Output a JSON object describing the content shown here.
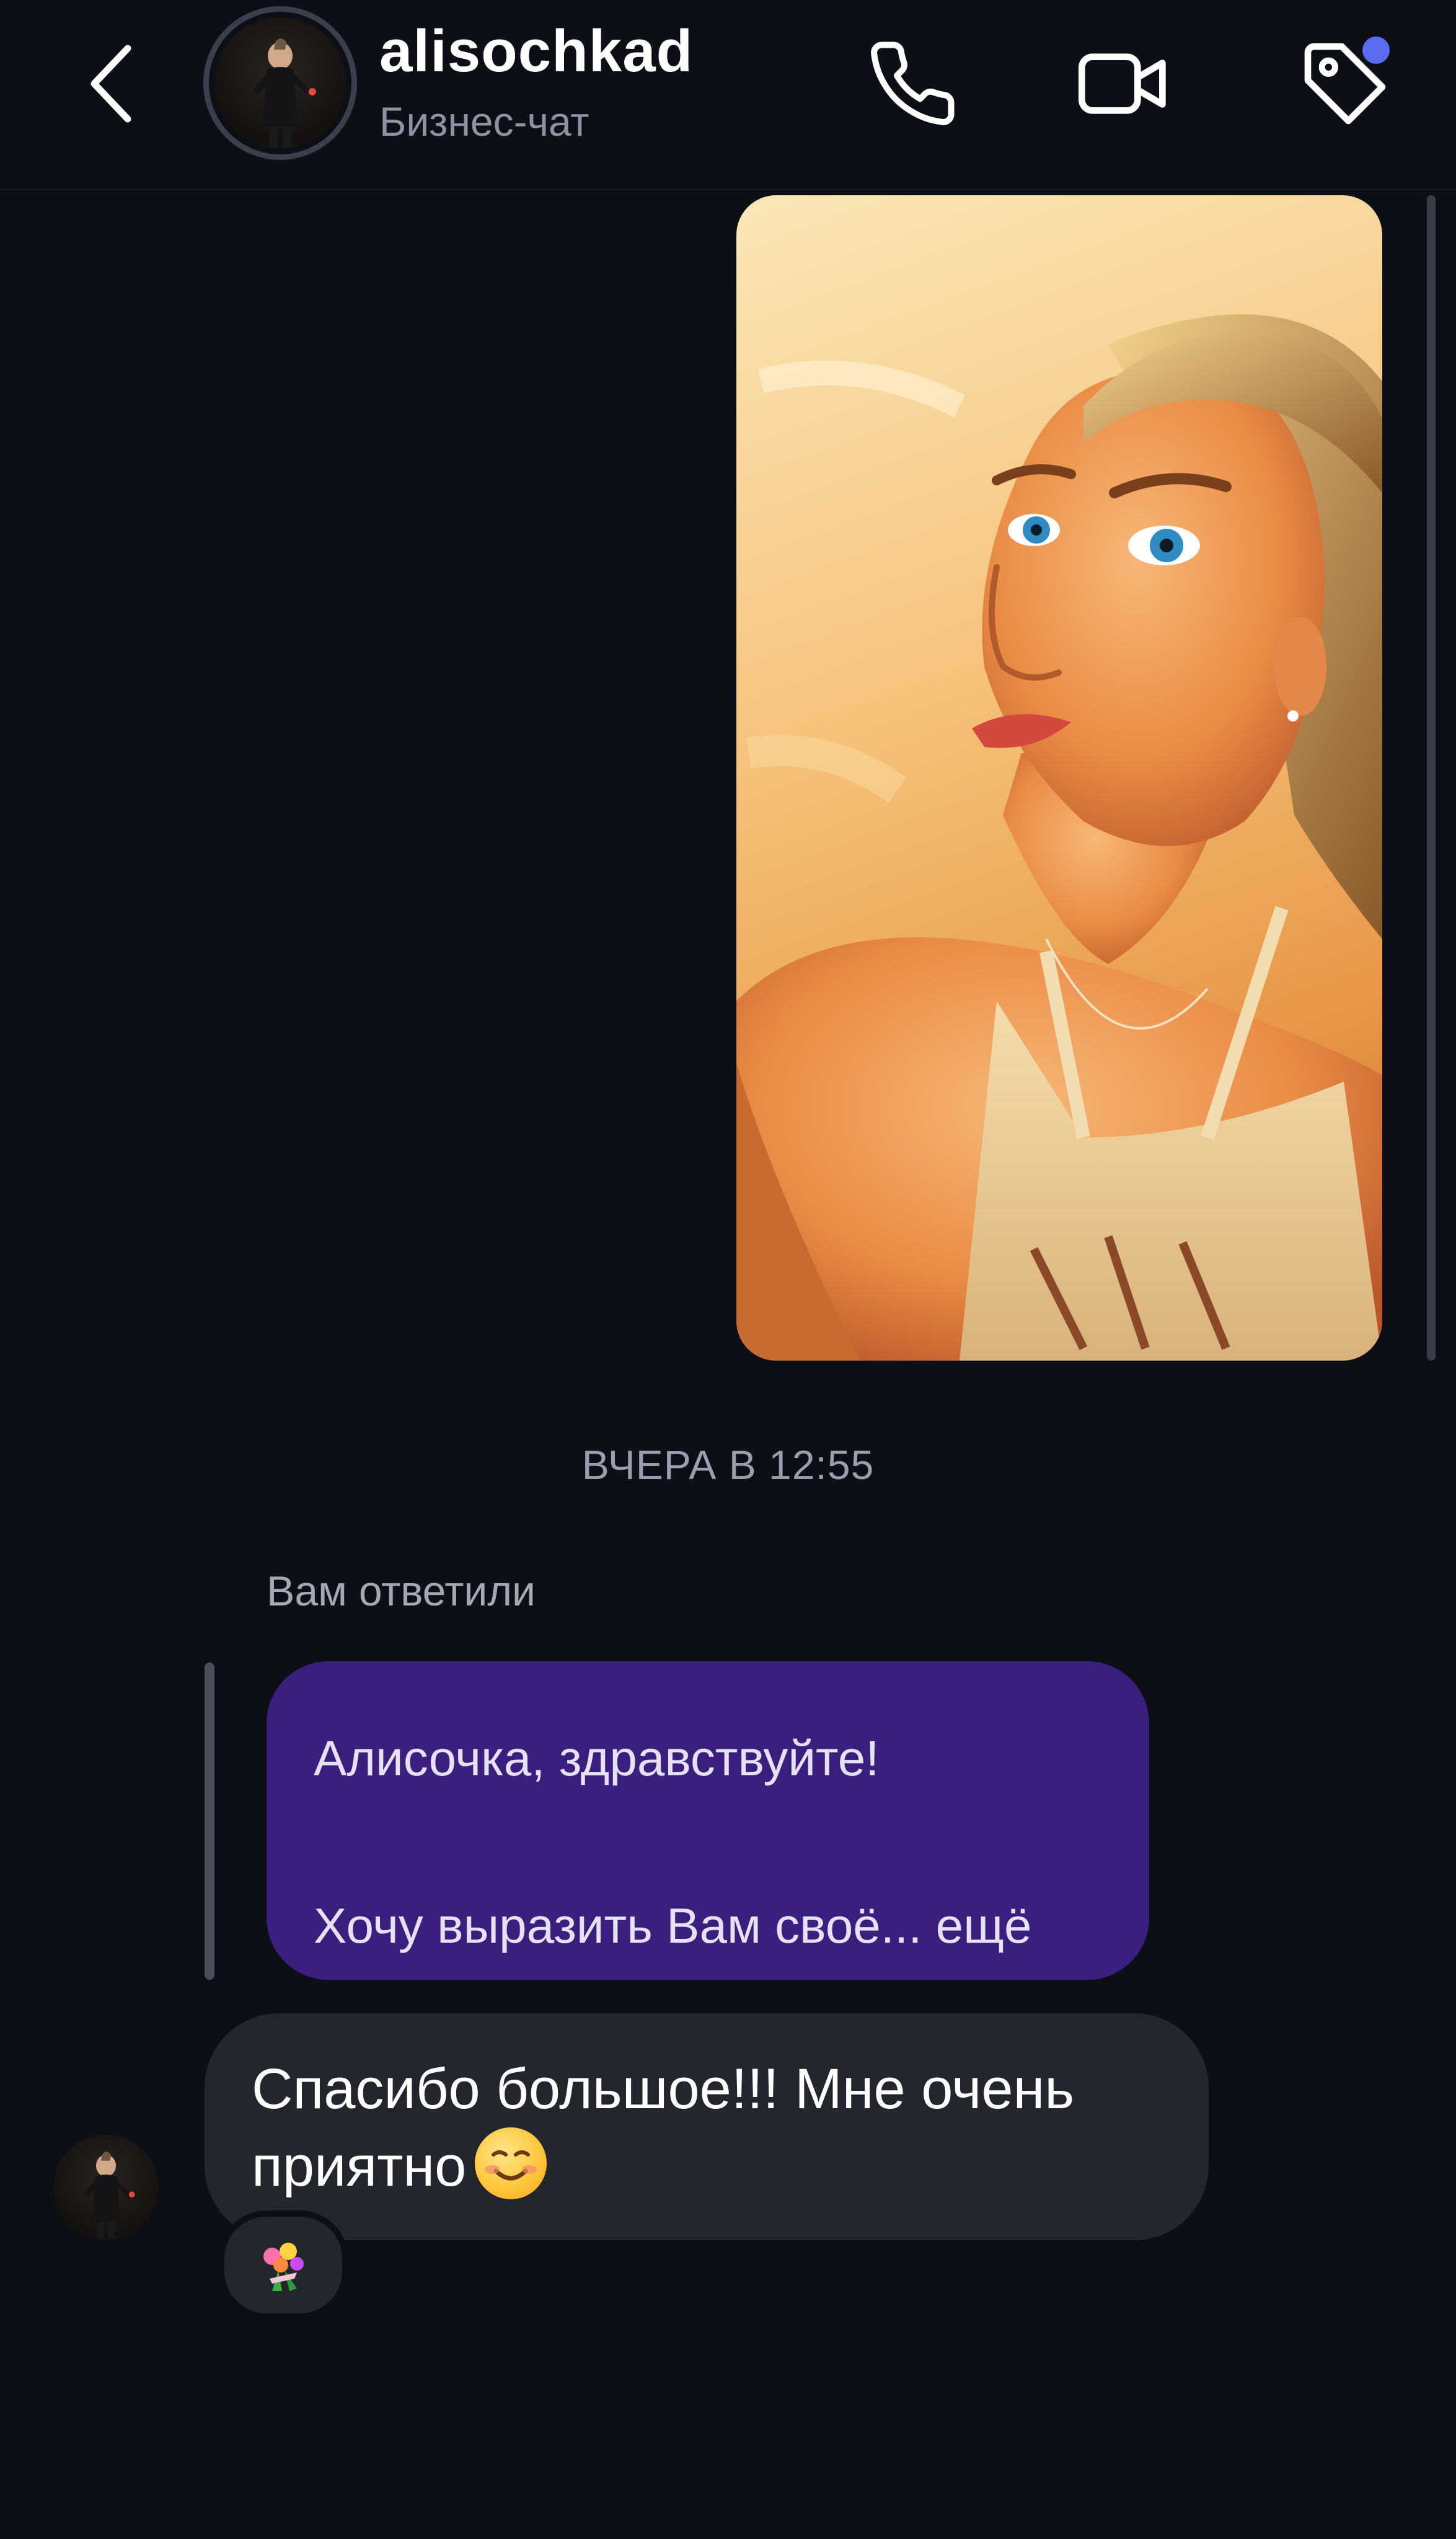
{
  "header": {
    "back_icon": "chevron-left-icon",
    "username": "alisochkad",
    "subtitle": "Бизнес-чат",
    "call_icon": "phone-icon",
    "video_icon": "video-camera-icon",
    "tag_icon": "tag-icon",
    "notification_dot_color": "#5b6cf2"
  },
  "messages": {
    "timestamp": "ВЧЕРА В 12:55",
    "reply": {
      "label": "Вам ответили",
      "line1": "Алисочка, здравствуйте!",
      "line2": "Хочу выразить Вам своё... ещё"
    },
    "incoming": {
      "line1": "Спасибо большое!!! Мне очень",
      "line2": "приятно",
      "emoji": "smiling-face-emoji",
      "reaction": "bouquet-emoji"
    }
  },
  "colors": {
    "background": "#0d0f17",
    "reply_bubble": "#3a1f7f",
    "incoming_bubble": "#24262e",
    "muted_text": "#9a9fad"
  }
}
